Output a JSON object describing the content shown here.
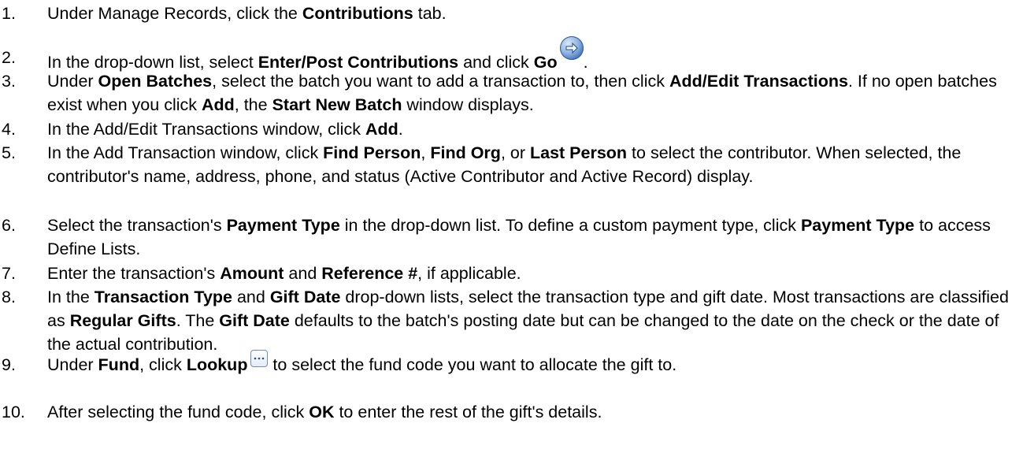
{
  "steps": [
    {
      "number": "1.",
      "parts": [
        {
          "t": "Under Manage Records, click the "
        },
        {
          "t": "Contributions",
          "b": true
        },
        {
          "t": " tab."
        }
      ]
    },
    {
      "number": "2.",
      "parts": [
        {
          "t": "In the drop-down list, select "
        },
        {
          "t": "Enter/Post Contributions",
          "b": true
        },
        {
          "t": " and click "
        },
        {
          "t": "Go",
          "b": true
        },
        {
          "icon": "go-arrow-icon"
        },
        {
          "t": "."
        }
      ]
    },
    {
      "number": "3.",
      "parts": [
        {
          "t": "Under "
        },
        {
          "t": "Open Batches",
          "b": true
        },
        {
          "t": ", select the batch you want to add a transaction to, then click "
        },
        {
          "t": "Add/Edit Transactions",
          "b": true
        },
        {
          "t": ". If no open batches exist when you click "
        },
        {
          "t": "Add",
          "b": true
        },
        {
          "t": ", the "
        },
        {
          "t": "Start New Batch",
          "b": true
        },
        {
          "t": " window displays."
        }
      ]
    },
    {
      "number": "4.",
      "parts": [
        {
          "t": "In the Add/Edit Transactions window, click "
        },
        {
          "t": "Add",
          "b": true
        },
        {
          "t": "."
        }
      ]
    },
    {
      "number": "5.",
      "parts": [
        {
          "t": "In the Add Transaction window, click "
        },
        {
          "t": "Find Person",
          "b": true
        },
        {
          "t": ", "
        },
        {
          "t": "Find Org",
          "b": true
        },
        {
          "t": ", or "
        },
        {
          "t": "Last Person",
          "b": true
        },
        {
          "t": " to select the contributor. When selected, the contributor's name, address, phone, and status (Active Contributor and Active Record) display."
        }
      ]
    },
    {
      "number": "6.",
      "parts": [
        {
          "t": "Select the transaction's "
        },
        {
          "t": "Payment Type",
          "b": true
        },
        {
          "t": " in the drop-down list. To define a custom payment type, click "
        },
        {
          "t": "Payment Type",
          "b": true
        },
        {
          "t": " to access Define Lists."
        }
      ]
    },
    {
      "number": "7.",
      "parts": [
        {
          "t": "Enter the transaction's "
        },
        {
          "t": "Amount",
          "b": true
        },
        {
          "t": " and "
        },
        {
          "t": "Reference #",
          "b": true
        },
        {
          "t": ", if applicable."
        }
      ]
    },
    {
      "number": "8.",
      "parts": [
        {
          "t": "In the "
        },
        {
          "t": "Transaction Type",
          "b": true
        },
        {
          "t": " and "
        },
        {
          "t": "Gift Date",
          "b": true
        },
        {
          "t": " drop-down lists, select the transaction type and gift date. Most transactions are classified as "
        },
        {
          "t": "Regular Gifts",
          "b": true
        },
        {
          "t": ". The "
        },
        {
          "t": "Gift Date",
          "b": true
        },
        {
          "t": " defaults to the batch's posting date but can be changed to the date on the check or the date of the actual contribution."
        }
      ]
    },
    {
      "number": "9.",
      "parts": [
        {
          "t": "Under "
        },
        {
          "t": "Fund",
          "b": true
        },
        {
          "t": ", click "
        },
        {
          "t": "Lookup",
          "b": true
        },
        {
          "icon": "lookup-ellipsis-icon"
        },
        {
          "t": " to select the fund code you want to allocate the gift to."
        }
      ]
    },
    {
      "number": "10.",
      "parts": [
        {
          "t": "After selecting the fund code, click "
        },
        {
          "t": "OK",
          "b": true
        },
        {
          "t": " to enter the rest of the gift's details."
        }
      ]
    }
  ]
}
